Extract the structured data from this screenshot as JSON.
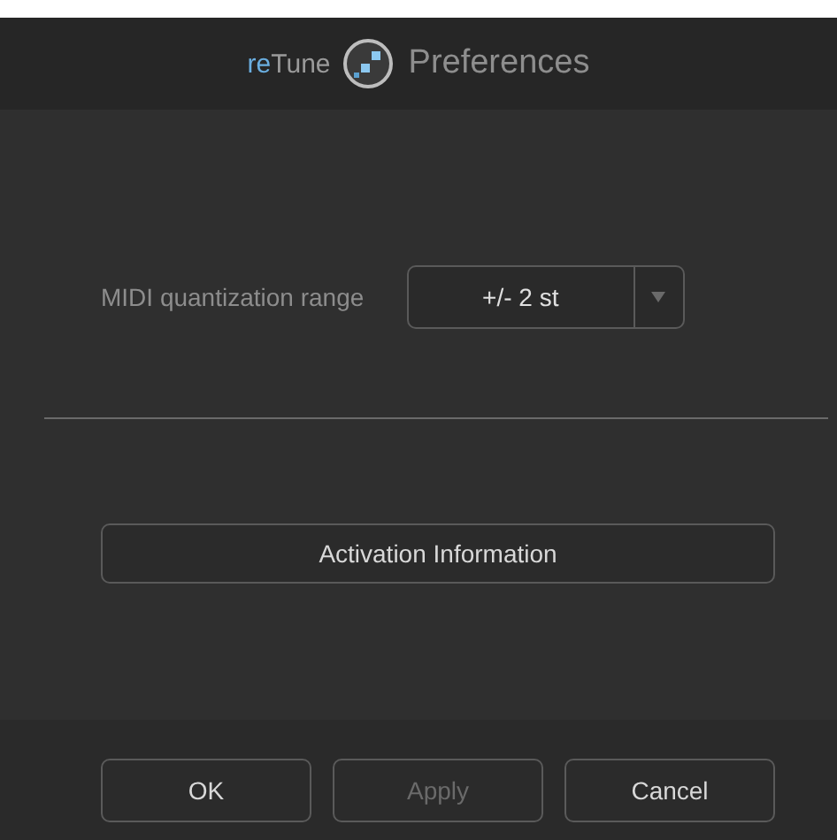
{
  "header": {
    "logo": {
      "accent": "re",
      "rest": "Tune"
    },
    "title": "Preferences"
  },
  "settings": [
    {
      "label": "MIDI quantization range",
      "value": "+/- 2 st"
    }
  ],
  "activation_button": "Activation Information",
  "buttons": [
    {
      "label": "OK",
      "disabled": false
    },
    {
      "label": "Apply",
      "disabled": true
    },
    {
      "label": "Cancel",
      "disabled": false
    }
  ]
}
